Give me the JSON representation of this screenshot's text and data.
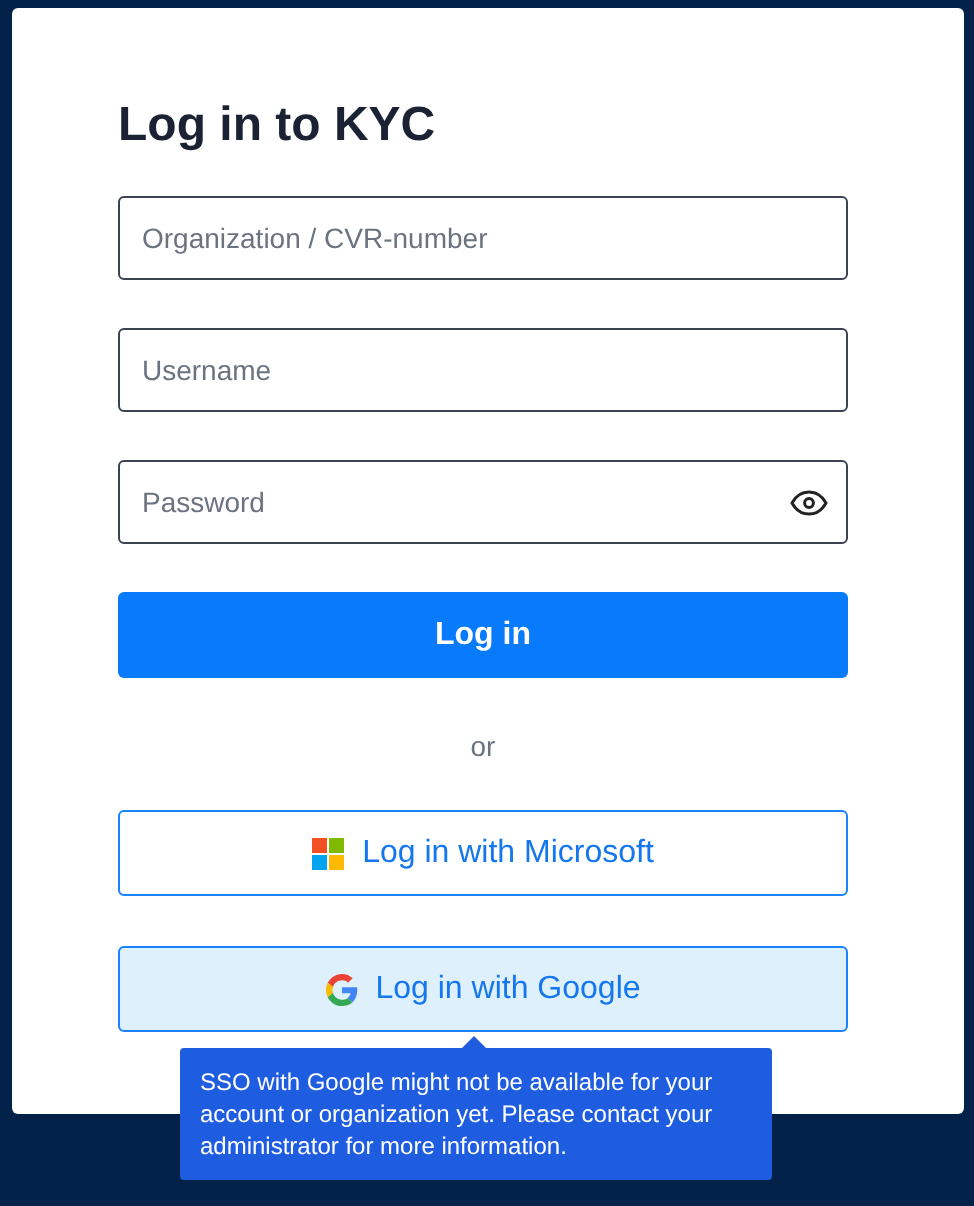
{
  "title": "Log in to KYC",
  "fields": [
    {
      "placeholder": "Organization / CVR-number",
      "kind": "text"
    },
    {
      "placeholder": "Username",
      "kind": "text"
    },
    {
      "placeholder": "Password",
      "kind": "password"
    }
  ],
  "login_button": "Log in",
  "separator": "or",
  "sso_buttons": [
    {
      "label": "Log in with Microsoft",
      "kind": "microsoft",
      "hovered": false
    },
    {
      "label": "Log in with Google",
      "kind": "google",
      "hovered": true
    }
  ],
  "tooltip": "SSO with Google might not be available for your account or organization yet. Please contact your administrator for more information."
}
